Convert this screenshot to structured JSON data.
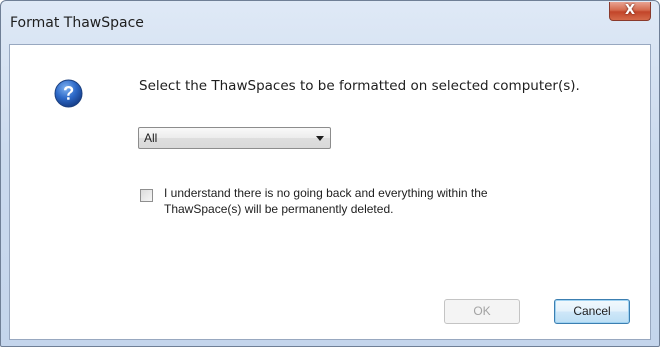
{
  "window": {
    "title": "Format ThawSpace",
    "close_glyph": "X"
  },
  "dialog": {
    "icon": "question-icon",
    "prompt": "Select the ThawSpaces to be formatted on selected computer(s).",
    "select": {
      "selected": "All"
    },
    "checkbox": {
      "checked": false,
      "label_line1": "I understand there is no going back and everything within the",
      "label_line2": "ThawSpace(s) will be permanently deleted."
    },
    "buttons": {
      "ok": "OK",
      "ok_enabled": false,
      "cancel": "Cancel"
    }
  },
  "colors": {
    "accent": "#2f63b8",
    "close": "#c94a2f",
    "frame": "#cbdaee"
  }
}
